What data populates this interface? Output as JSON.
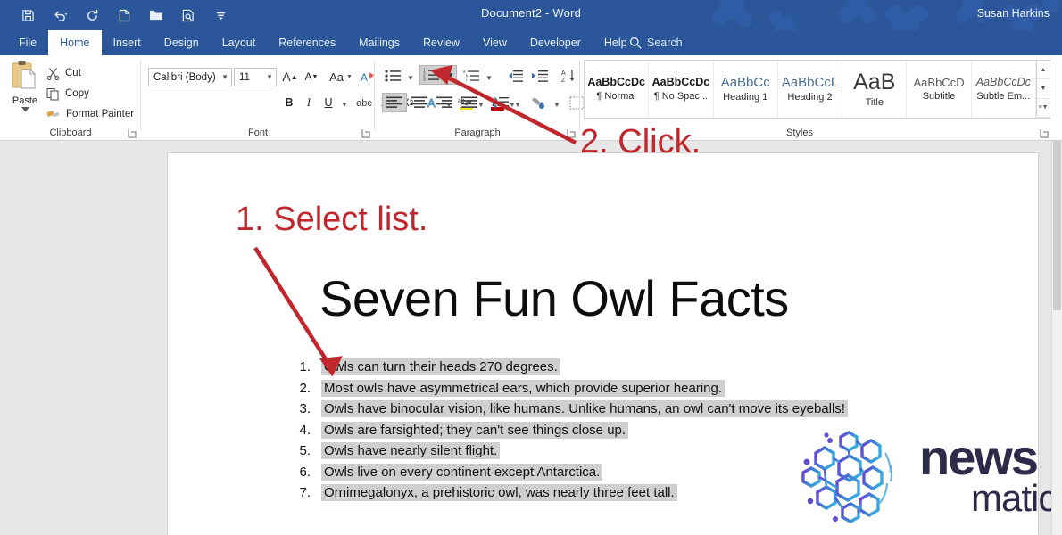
{
  "window": {
    "title": "Document2  -  Word",
    "user": "Susan Harkins",
    "accent_color": "#2b579a"
  },
  "quick_access": [
    {
      "name": "save-icon",
      "label": "Save"
    },
    {
      "name": "undo-icon",
      "label": "Undo"
    },
    {
      "name": "redo-icon",
      "label": "Redo"
    },
    {
      "name": "new-document-icon",
      "label": "New"
    },
    {
      "name": "open-folder-icon",
      "label": "Open"
    },
    {
      "name": "print-preview-icon",
      "label": "Print Preview and Print"
    },
    {
      "name": "customize-quick-access-icon",
      "label": "Customize Quick Access Toolbar"
    }
  ],
  "tabs": [
    {
      "label": "File",
      "active": false
    },
    {
      "label": "Home",
      "active": true
    },
    {
      "label": "Insert",
      "active": false
    },
    {
      "label": "Design",
      "active": false
    },
    {
      "label": "Layout",
      "active": false
    },
    {
      "label": "References",
      "active": false
    },
    {
      "label": "Mailings",
      "active": false
    },
    {
      "label": "Review",
      "active": false
    },
    {
      "label": "View",
      "active": false
    },
    {
      "label": "Developer",
      "active": false
    },
    {
      "label": "Help",
      "active": false
    }
  ],
  "search": {
    "label": "Search"
  },
  "ribbon": {
    "clipboard": {
      "group_label": "Clipboard",
      "paste_label": "Paste",
      "items": [
        {
          "label": "Cut",
          "icon": "scissors-icon"
        },
        {
          "label": "Copy",
          "icon": "copy-icon"
        },
        {
          "label": "Format Painter",
          "icon": "format-painter-icon"
        }
      ]
    },
    "font": {
      "group_label": "Font",
      "font_name": "Calibri (Body)",
      "font_size": "11",
      "buttons": [
        {
          "name": "grow-font",
          "glyph": "A"
        },
        {
          "name": "shrink-font",
          "glyph": "A"
        },
        {
          "name": "change-case",
          "glyph": "Aa"
        },
        {
          "name": "clear-formatting",
          "glyph": "A"
        },
        {
          "name": "bold",
          "glyph": "B"
        },
        {
          "name": "italic",
          "glyph": "I"
        },
        {
          "name": "underline",
          "glyph": "U"
        },
        {
          "name": "strikethrough",
          "glyph": "abc"
        },
        {
          "name": "subscript",
          "glyph": "X₂"
        },
        {
          "name": "superscript",
          "glyph": "X²"
        },
        {
          "name": "text-effects",
          "glyph": "A"
        },
        {
          "name": "text-highlight-color",
          "glyph": "ab"
        },
        {
          "name": "font-color",
          "glyph": "A"
        }
      ]
    },
    "paragraph": {
      "group_label": "Paragraph",
      "numbering_selected": true
    },
    "styles": {
      "group_label": "Styles",
      "items": [
        {
          "preview": "AaBbCcDc",
          "name": "¶ Normal"
        },
        {
          "preview": "AaBbCcDc",
          "name": "¶ No Spac..."
        },
        {
          "preview": "AaBbCc",
          "name": "Heading 1"
        },
        {
          "preview": "AaBbCcL",
          "name": "Heading 2"
        },
        {
          "preview": "AaB",
          "name": "Title"
        },
        {
          "preview": "AaBbCcD",
          "name": "Subtitle"
        },
        {
          "preview": "AaBbCcDc",
          "name": "Subtle Em..."
        }
      ]
    }
  },
  "document": {
    "heading": "Seven Fun Owl Facts",
    "list": [
      {
        "number": "1.",
        "text": "Owls can turn their heads 270 degrees."
      },
      {
        "number": "2.",
        "text": "Most owls have asymmetrical ears, which provide superior hearing."
      },
      {
        "number": "3.",
        "text": "Owls have binocular vision, like humans. Unlike humans, an owl can't move its eyeballs!"
      },
      {
        "number": "4.",
        "text": "Owls are farsighted; they can't see things close up."
      },
      {
        "number": "5.",
        "text": "Owls have nearly silent flight."
      },
      {
        "number": "6.",
        "text": "Owls live on every continent except Antarctica."
      },
      {
        "number": "7.",
        "text": "Ornimegalonyx, a prehistoric owl, was nearly three feet tall."
      }
    ]
  },
  "annotations": [
    {
      "name": "step-1-annotation",
      "text": "1. Select list.",
      "color": "#c0272d"
    },
    {
      "name": "step-2-annotation",
      "text": "2. Click.",
      "color": "#c0272d"
    }
  ],
  "watermark": {
    "word_top": "news",
    "word_bottom": "matic",
    "color": "#2d2a4a"
  }
}
